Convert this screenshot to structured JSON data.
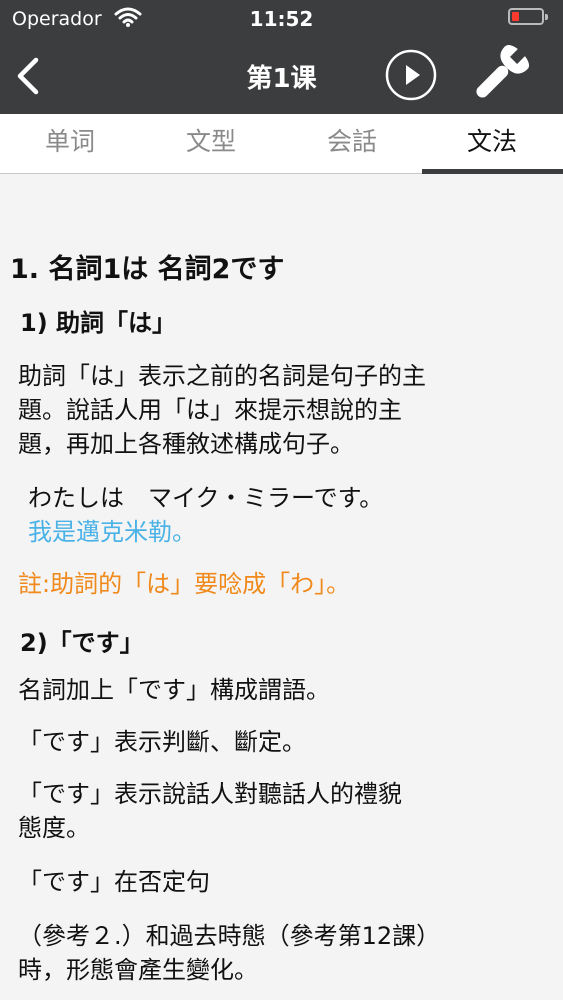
{
  "status_bar": {
    "carrier": "Operador",
    "time": "11:52"
  },
  "nav": {
    "title": "第1课",
    "back_icon": "chevron-left-icon",
    "play_icon": "play-circle-icon",
    "settings_icon": "wrench-icon"
  },
  "tabs": [
    {
      "label": "单词"
    },
    {
      "label": "文型"
    },
    {
      "label": "会話"
    },
    {
      "label": "文法"
    }
  ],
  "active_tab": "文法",
  "content": {
    "section_title": "1. 名詞1は 名詞2です",
    "sub1_title": "1) 助詞「は」",
    "sub1_p1_line1": "助詞「は」表示之前的名詞是句子的主",
    "sub1_p1_line2": "題。說話人用「は」來提示想說的主",
    "sub1_p1_line3": "題，再加上各種敘述構成句子。",
    "example_jp": "わたしは　マイク・ミラーです。",
    "example_cn": "我是邁克米勒。",
    "note": "註:助詞的「は」要唸成「わ」。",
    "sub2_title": "2)「です」",
    "sub2_p1": "名詞加上「です」構成謂語。",
    "sub2_p2": "「です」表示判斷、斷定。",
    "sub2_p3_line1": "「です」表示說話人對聽話人的禮貌",
    "sub2_p3_line2": "態度。",
    "sub2_p4": "「です」在否定句",
    "sub2_p5_line1": "（參考２.）和過去時態（參考第12課）",
    "sub2_p5_line2": "時，形態會產生變化。"
  },
  "colors": {
    "nav_bg": "#3c3d3f",
    "example_cn": "#4ab2e6",
    "note": "#f08a1c",
    "battery": "#ff3b30"
  }
}
